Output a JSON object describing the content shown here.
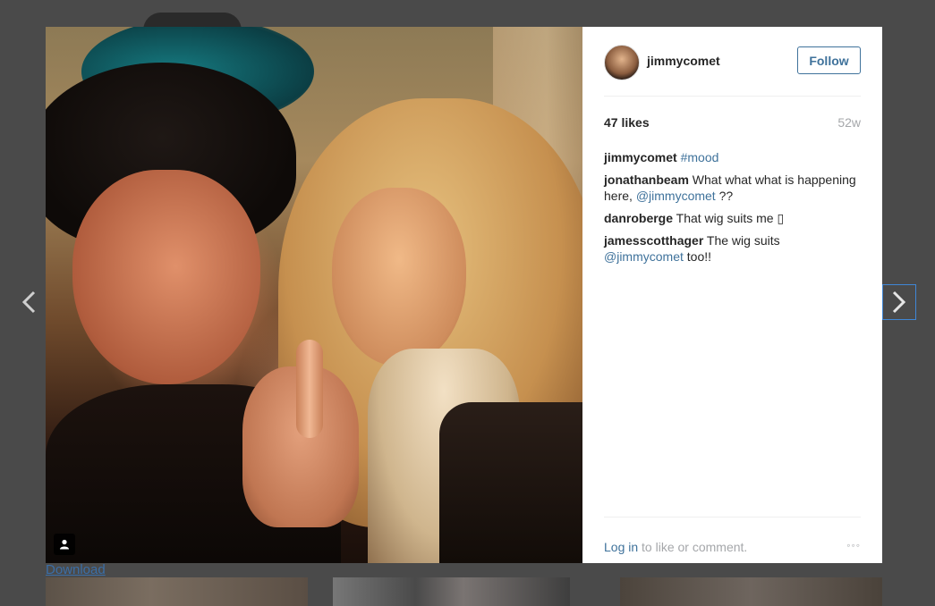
{
  "nav": {
    "prev_icon": "chevron-left-icon",
    "next_icon": "chevron-right-icon"
  },
  "post": {
    "username": "jimmycomet",
    "follow_label": "Follow",
    "likes": "47 likes",
    "age": "52w",
    "tag_icon": "person-tag-icon"
  },
  "comments": [
    {
      "user": "jimmycomet",
      "parts": [
        {
          "text": "#mood",
          "link": true
        }
      ]
    },
    {
      "user": "jonathanbeam",
      "parts": [
        {
          "text": "What what what is happening here, ",
          "link": false
        },
        {
          "text": "@jimmycomet",
          "link": true
        },
        {
          "text": " ??",
          "link": false
        }
      ]
    },
    {
      "user": "danroberge",
      "parts": [
        {
          "text": "That wig suits me ▯",
          "link": false
        }
      ]
    },
    {
      "user": "jamesscotthager",
      "parts": [
        {
          "text": "The wig suits ",
          "link": false
        },
        {
          "text": "@jimmycomet",
          "link": true
        },
        {
          "text": " too!!",
          "link": false
        }
      ]
    }
  ],
  "footer": {
    "login_label": "Log in",
    "login_suffix": " to like or comment.",
    "more_label": "◦◦◦"
  },
  "download_label": "Download",
  "colors": {
    "link": "#3f729b",
    "backdrop": "#4a4a4a",
    "focus_outline": "#3f86d6"
  }
}
